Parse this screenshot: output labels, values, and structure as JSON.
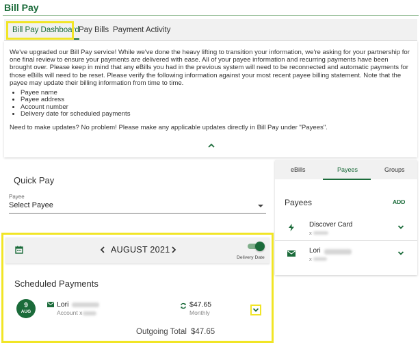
{
  "page": {
    "title": "Bill Pay"
  },
  "tabs": [
    {
      "label": "Bill Pay Dashboard",
      "active": true
    },
    {
      "label": "Pay Bills",
      "active": false
    },
    {
      "label": "Payment Activity",
      "active": false
    }
  ],
  "notice": {
    "intro": "We've upgraded our Bill Pay service! While we've done the heavy lifting to transition your information, we're asking for your partnership for one final review to ensure your payments are delivered with ease. All of your payee information and recurring payments have been brought over. Please keep in mind that any eBills you had in the previous system will need to be reconnected and automatic payments for those eBills will need to be reset. Please verify the following information against your most recent payee billing statement. Note that the payee may update their billing information from time to time.",
    "items": [
      "Payee name",
      "Payee address",
      "Account number",
      "Delivery date for scheduled payments"
    ],
    "updates": "Need to make updates? No problem! Please make any applicable updates directly in Bill Pay under \"Payees\"."
  },
  "quick_pay": {
    "title": "Quick Pay",
    "payee_label": "Payee",
    "payee_value": "Select Payee"
  },
  "calendar": {
    "month": "AUGUST 2021",
    "toggle_label": "Delivery Date",
    "toggle_on": true
  },
  "scheduled": {
    "title": "Scheduled Payments",
    "payments": [
      {
        "day": "9",
        "month": "AUG",
        "name": "Lori",
        "account": "Account x",
        "amount": "$47.65",
        "frequency": "Monthly"
      }
    ],
    "total_label": "Outgoing Total",
    "total_value": "$47.65"
  },
  "side_panel": {
    "tabs": [
      {
        "label": "eBills",
        "active": false
      },
      {
        "label": "Payees",
        "active": true
      },
      {
        "label": "Groups",
        "active": false
      }
    ],
    "title": "Payees",
    "add_label": "ADD",
    "payees": [
      {
        "name": "Discover Card",
        "sub": "x",
        "icon": "lightning-icon"
      },
      {
        "name": "Lori",
        "sub": "x",
        "icon": "mail-icon"
      }
    ]
  },
  "colors": {
    "brand": "#1b6b3a",
    "highlight": "#f1e526",
    "panel": "#f1f1f1"
  }
}
